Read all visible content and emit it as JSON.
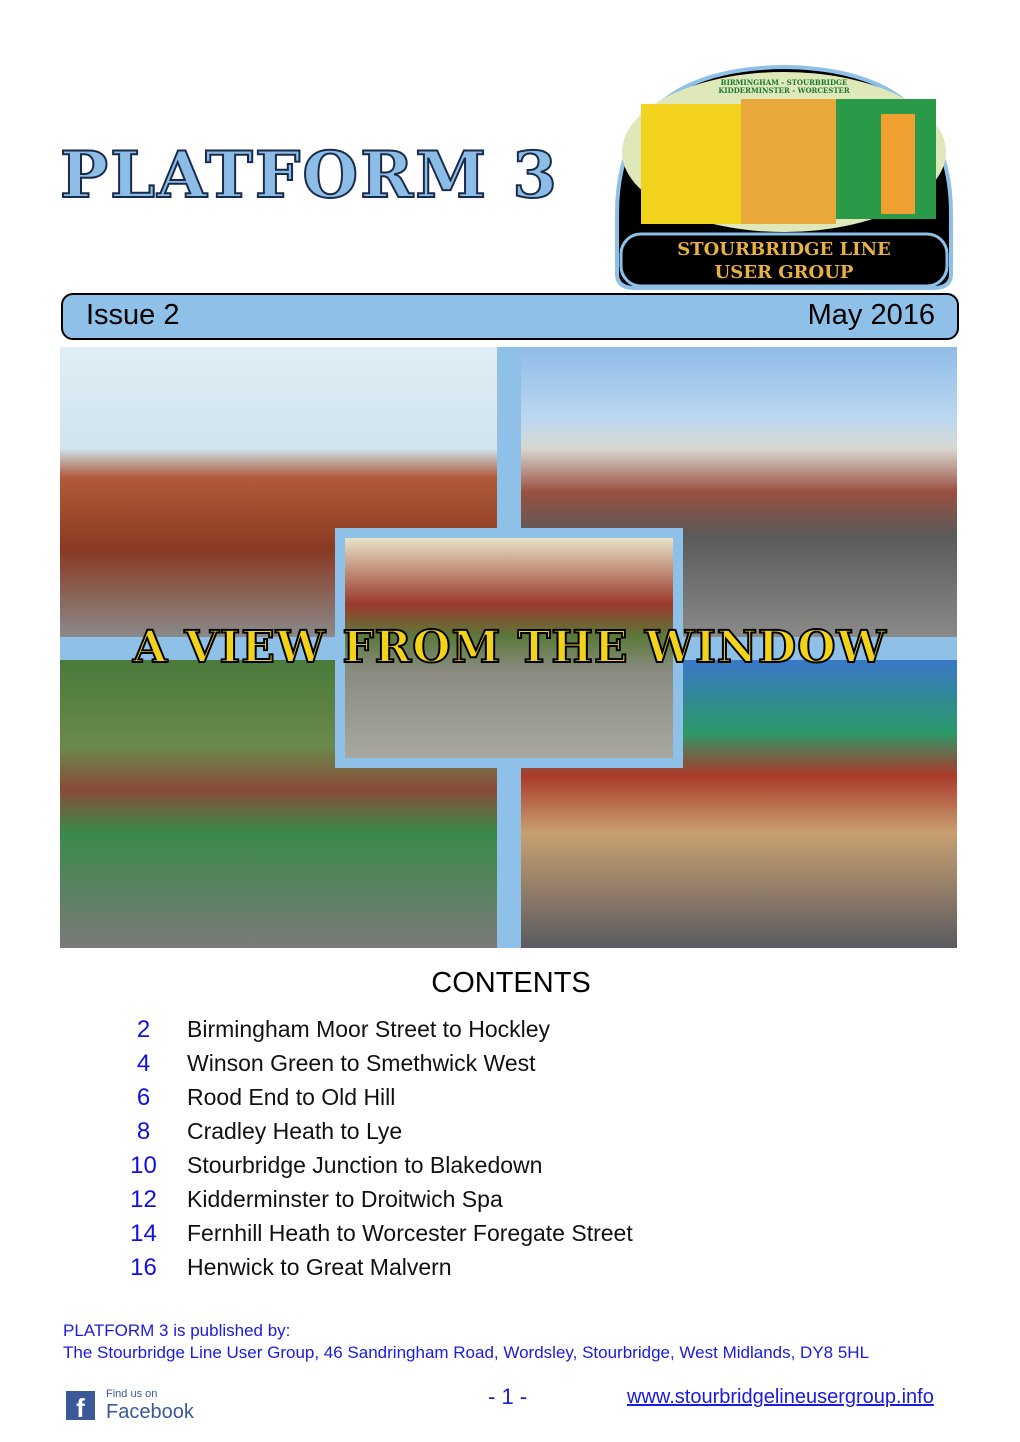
{
  "header": {
    "title": "PLATFORM 3",
    "issue": "Issue 2",
    "date": "May 2016"
  },
  "logo": {
    "top_line1": "BIRMINGHAM - STOURBRIDGE",
    "top_line2": "KIDDERMINSTER - WORCESTER",
    "name_line1": "STOURBRIDGE LINE",
    "name_line2": "USER GROUP"
  },
  "cover": {
    "banner": "A VIEW FROM THE WINDOW"
  },
  "contents": {
    "heading": "CONTENTS",
    "items": [
      {
        "page": "2",
        "title": "Birmingham Moor Street to Hockley"
      },
      {
        "page": "4",
        "title": "Winson Green to Smethwick West"
      },
      {
        "page": "6",
        "title": "Rood End to Old Hill"
      },
      {
        "page": "8",
        "title": "Cradley Heath to Lye"
      },
      {
        "page": "10",
        "title": "Stourbridge Junction to Blakedown"
      },
      {
        "page": "12",
        "title": "Kidderminster to Droitwich Spa"
      },
      {
        "page": "14",
        "title": "Fernhill Heath to Worcester Foregate Street"
      },
      {
        "page": "16",
        "title": "Henwick to Great Malvern"
      }
    ]
  },
  "footer": {
    "published_by": "PLATFORM 3 is published by:",
    "address": "The Stourbridge Line User Group, 46 Sandringham Road, Wordsley, Stourbridge, West Midlands, DY8 5HL",
    "facebook_small": "Find us on",
    "facebook_big": "Facebook",
    "page_number": "- 1 -",
    "website": "www.stourbridgelineusergroup.info"
  },
  "colors": {
    "accent": "#8fc0e8",
    "link": "#1a1ae0",
    "banner": "#f3d21a"
  }
}
